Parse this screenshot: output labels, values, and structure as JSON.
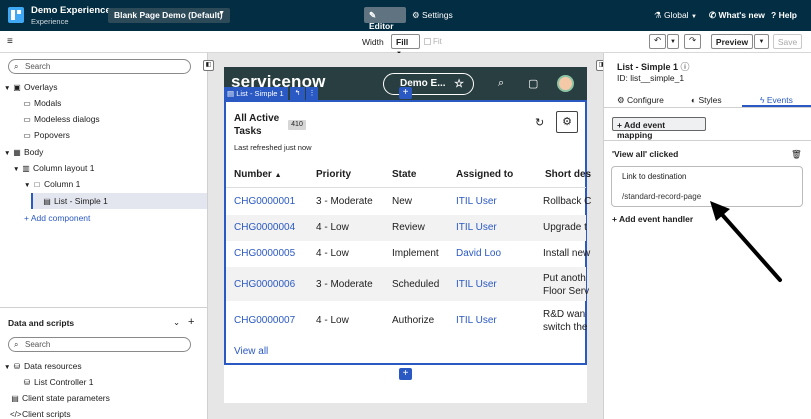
{
  "topbar": {
    "app_name": "Demo Experience",
    "app_sub": "Experience",
    "page_select": "Blank Page Demo (Default)",
    "editor_tab": "Editor",
    "settings_tab": "Settings",
    "global": "Global",
    "whats_new": "What's new",
    "help": "Help"
  },
  "toolbar": {
    "width_label": "Width",
    "fill_value": "Fill",
    "fit_label": "Fit",
    "preview_label": "Preview",
    "save_label": "Save"
  },
  "left_panel": {
    "search_placeholder": "Search",
    "tree": {
      "overlays": "Overlays",
      "modals": "Modals",
      "modeless": "Modeless dialogs",
      "popovers": "Popovers",
      "body": "Body",
      "column_layout": "Column layout 1",
      "column": "Column 1",
      "list": "List - Simple 1",
      "add_component": "+ Add component"
    },
    "data_scripts": {
      "title": "Data and scripts",
      "search_placeholder": "Search",
      "data_resources": "Data resources",
      "list_controller": "List Controller 1",
      "client_state": "Client state parameters",
      "client_scripts": "Client scripts"
    }
  },
  "canvas": {
    "sn_logo": "servicenow",
    "sn_pill": "Demo E...",
    "component_tag": "List - Simple 1",
    "list": {
      "title": "All Active Tasks",
      "count": "410",
      "refresh_text": "Last refreshed just now",
      "columns": [
        "Number",
        "Priority",
        "State",
        "Assigned to",
        "Short des"
      ],
      "rows": [
        {
          "number": "CHG0000001",
          "priority": "3 - Moderate",
          "state": "New",
          "assigned": "ITIL User",
          "short": "Rollback C"
        },
        {
          "number": "CHG0000004",
          "priority": "4 - Low",
          "state": "Review",
          "assigned": "ITIL User",
          "short": "Upgrade t"
        },
        {
          "number": "CHG0000005",
          "priority": "4 - Low",
          "state": "Implement",
          "assigned": "David Loo",
          "short": "Install new"
        },
        {
          "number": "CHG0000006",
          "priority": "3 - Moderate",
          "state": "Scheduled",
          "assigned": "ITIL User",
          "short": "Put anoth",
          "short2": "Floor Serv"
        },
        {
          "number": "CHG0000007",
          "priority": "4 - Low",
          "state": "Authorize",
          "assigned": "ITIL User",
          "short": "R&D wan",
          "short2": "switch the"
        }
      ],
      "view_all": "View all"
    }
  },
  "right_panel": {
    "title": "List - Simple 1",
    "id": "ID: list__simple_1",
    "tabs": [
      "Configure",
      "Styles",
      "Events"
    ],
    "add_mapping": "+ Add event mapping",
    "event_title": "'View all' clicked",
    "event_label": "Link to destination",
    "event_value": "/standard-record-page",
    "add_handler": "+ Add event handler"
  },
  "colors": {
    "topbar": "#032d42",
    "accent": "#2b59c3",
    "sn_header": "#293e40"
  }
}
